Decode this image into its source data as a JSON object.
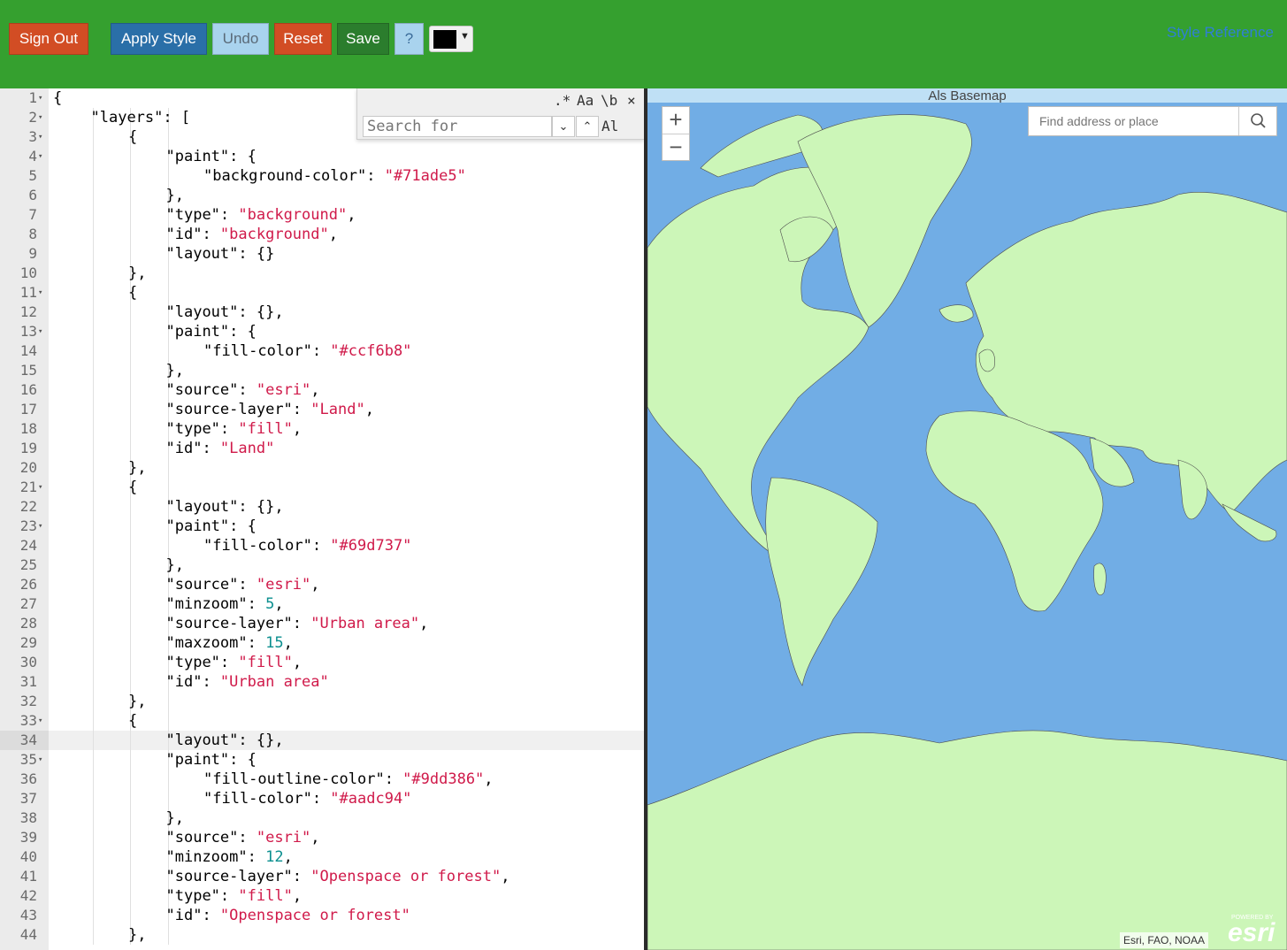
{
  "toolbar": {
    "sign_out": "Sign Out",
    "apply_style": "Apply Style",
    "undo": "Undo",
    "reset": "Reset",
    "save": "Save",
    "help": "?",
    "color_value": "#000000",
    "style_reference": "Style Reference",
    "colors": {
      "bar": "#35a02f",
      "danger": "#d24d24",
      "primary": "#2a6fa8",
      "light": "#a9d3ee",
      "save": "#2b7d2d"
    }
  },
  "search_box": {
    "regex": ".*",
    "case": "Aa",
    "word": "\\b",
    "close": "×",
    "placeholder": "Search for",
    "all": "Al"
  },
  "map": {
    "title": "Als Basemap",
    "zoom_in": "+",
    "zoom_out": "−",
    "search_placeholder": "Find address or place",
    "attribution": "Esri, FAO, NOAA",
    "powered_by": "POWERED BY",
    "logo": "esri",
    "water_color": "#71ade5",
    "land_color": "#ccf6b8"
  },
  "editor": {
    "active_line": 34,
    "lines": [
      {
        "n": "1",
        "i": 0,
        "fold": true,
        "t": [
          [
            "p",
            "{"
          ]
        ]
      },
      {
        "n": "2",
        "i": 1,
        "fold": true,
        "t": [
          [
            "p",
            "\"layers\": ["
          ]
        ]
      },
      {
        "n": "3",
        "i": 2,
        "fold": true,
        "t": [
          [
            "p",
            "{"
          ]
        ]
      },
      {
        "n": "4",
        "i": 3,
        "fold": true,
        "t": [
          [
            "p",
            "\"paint\": {"
          ]
        ]
      },
      {
        "n": "5",
        "i": 4,
        "fold": false,
        "t": [
          [
            "p",
            "\"background-color\": "
          ],
          [
            "s",
            "\"#71ade5\""
          ]
        ]
      },
      {
        "n": "6",
        "i": 3,
        "fold": false,
        "t": [
          [
            "p",
            "},"
          ]
        ]
      },
      {
        "n": "7",
        "i": 3,
        "fold": false,
        "t": [
          [
            "p",
            "\"type\": "
          ],
          [
            "s",
            "\"background\""
          ],
          [
            "p",
            ","
          ]
        ]
      },
      {
        "n": "8",
        "i": 3,
        "fold": false,
        "t": [
          [
            "p",
            "\"id\": "
          ],
          [
            "s",
            "\"background\""
          ],
          [
            "p",
            ","
          ]
        ]
      },
      {
        "n": "9",
        "i": 3,
        "fold": false,
        "t": [
          [
            "p",
            "\"layout\": {}"
          ]
        ]
      },
      {
        "n": "10",
        "i": 2,
        "fold": false,
        "t": [
          [
            "p",
            "},"
          ]
        ]
      },
      {
        "n": "11",
        "i": 2,
        "fold": true,
        "t": [
          [
            "p",
            "{"
          ]
        ]
      },
      {
        "n": "12",
        "i": 3,
        "fold": false,
        "t": [
          [
            "p",
            "\"layout\": {},"
          ]
        ]
      },
      {
        "n": "13",
        "i": 3,
        "fold": true,
        "t": [
          [
            "p",
            "\"paint\": {"
          ]
        ]
      },
      {
        "n": "14",
        "i": 4,
        "fold": false,
        "t": [
          [
            "p",
            "\"fill-color\": "
          ],
          [
            "s",
            "\"#ccf6b8\""
          ]
        ]
      },
      {
        "n": "15",
        "i": 3,
        "fold": false,
        "t": [
          [
            "p",
            "},"
          ]
        ]
      },
      {
        "n": "16",
        "i": 3,
        "fold": false,
        "t": [
          [
            "p",
            "\"source\": "
          ],
          [
            "s",
            "\"esri\""
          ],
          [
            "p",
            ","
          ]
        ]
      },
      {
        "n": "17",
        "i": 3,
        "fold": false,
        "t": [
          [
            "p",
            "\"source-layer\": "
          ],
          [
            "s",
            "\"Land\""
          ],
          [
            "p",
            ","
          ]
        ]
      },
      {
        "n": "18",
        "i": 3,
        "fold": false,
        "t": [
          [
            "p",
            "\"type\": "
          ],
          [
            "s",
            "\"fill\""
          ],
          [
            "p",
            ","
          ]
        ]
      },
      {
        "n": "19",
        "i": 3,
        "fold": false,
        "t": [
          [
            "p",
            "\"id\": "
          ],
          [
            "s",
            "\"Land\""
          ]
        ]
      },
      {
        "n": "20",
        "i": 2,
        "fold": false,
        "t": [
          [
            "p",
            "},"
          ]
        ]
      },
      {
        "n": "21",
        "i": 2,
        "fold": true,
        "t": [
          [
            "p",
            "{"
          ]
        ]
      },
      {
        "n": "22",
        "i": 3,
        "fold": false,
        "t": [
          [
            "p",
            "\"layout\": {},"
          ]
        ]
      },
      {
        "n": "23",
        "i": 3,
        "fold": true,
        "t": [
          [
            "p",
            "\"paint\": {"
          ]
        ]
      },
      {
        "n": "24",
        "i": 4,
        "fold": false,
        "t": [
          [
            "p",
            "\"fill-color\": "
          ],
          [
            "s",
            "\"#69d737\""
          ]
        ]
      },
      {
        "n": "25",
        "i": 3,
        "fold": false,
        "t": [
          [
            "p",
            "},"
          ]
        ]
      },
      {
        "n": "26",
        "i": 3,
        "fold": false,
        "t": [
          [
            "p",
            "\"source\": "
          ],
          [
            "s",
            "\"esri\""
          ],
          [
            "p",
            ","
          ]
        ]
      },
      {
        "n": "27",
        "i": 3,
        "fold": false,
        "t": [
          [
            "p",
            "\"minzoom\": "
          ],
          [
            "n",
            "5"
          ],
          [
            "p",
            ","
          ]
        ]
      },
      {
        "n": "28",
        "i": 3,
        "fold": false,
        "t": [
          [
            "p",
            "\"source-layer\": "
          ],
          [
            "s",
            "\"Urban area\""
          ],
          [
            "p",
            ","
          ]
        ]
      },
      {
        "n": "29",
        "i": 3,
        "fold": false,
        "t": [
          [
            "p",
            "\"maxzoom\": "
          ],
          [
            "n",
            "15"
          ],
          [
            "p",
            ","
          ]
        ]
      },
      {
        "n": "30",
        "i": 3,
        "fold": false,
        "t": [
          [
            "p",
            "\"type\": "
          ],
          [
            "s",
            "\"fill\""
          ],
          [
            "p",
            ","
          ]
        ]
      },
      {
        "n": "31",
        "i": 3,
        "fold": false,
        "t": [
          [
            "p",
            "\"id\": "
          ],
          [
            "s",
            "\"Urban area\""
          ]
        ]
      },
      {
        "n": "32",
        "i": 2,
        "fold": false,
        "t": [
          [
            "p",
            "},"
          ]
        ]
      },
      {
        "n": "33",
        "i": 2,
        "fold": true,
        "t": [
          [
            "p",
            "{"
          ]
        ]
      },
      {
        "n": "34",
        "i": 3,
        "fold": false,
        "t": [
          [
            "p",
            "\"layout\": {},"
          ]
        ]
      },
      {
        "n": "35",
        "i": 3,
        "fold": true,
        "t": [
          [
            "p",
            "\"paint\": {"
          ]
        ]
      },
      {
        "n": "36",
        "i": 4,
        "fold": false,
        "t": [
          [
            "p",
            "\"fill-outline-color\": "
          ],
          [
            "s",
            "\"#9dd386\""
          ],
          [
            "p",
            ","
          ]
        ]
      },
      {
        "n": "37",
        "i": 4,
        "fold": false,
        "t": [
          [
            "p",
            "\"fill-color\": "
          ],
          [
            "s",
            "\"#aadc94\""
          ]
        ]
      },
      {
        "n": "38",
        "i": 3,
        "fold": false,
        "t": [
          [
            "p",
            "},"
          ]
        ]
      },
      {
        "n": "39",
        "i": 3,
        "fold": false,
        "t": [
          [
            "p",
            "\"source\": "
          ],
          [
            "s",
            "\"esri\""
          ],
          [
            "p",
            ","
          ]
        ]
      },
      {
        "n": "40",
        "i": 3,
        "fold": false,
        "t": [
          [
            "p",
            "\"minzoom\": "
          ],
          [
            "n",
            "12"
          ],
          [
            "p",
            ","
          ]
        ]
      },
      {
        "n": "41",
        "i": 3,
        "fold": false,
        "t": [
          [
            "p",
            "\"source-layer\": "
          ],
          [
            "s",
            "\"Openspace or forest\""
          ],
          [
            "p",
            ","
          ]
        ]
      },
      {
        "n": "42",
        "i": 3,
        "fold": false,
        "t": [
          [
            "p",
            "\"type\": "
          ],
          [
            "s",
            "\"fill\""
          ],
          [
            "p",
            ","
          ]
        ]
      },
      {
        "n": "43",
        "i": 3,
        "fold": false,
        "t": [
          [
            "p",
            "\"id\": "
          ],
          [
            "s",
            "\"Openspace or forest\""
          ]
        ]
      },
      {
        "n": "44",
        "i": 2,
        "fold": false,
        "t": [
          [
            "p",
            "},"
          ]
        ]
      }
    ]
  }
}
